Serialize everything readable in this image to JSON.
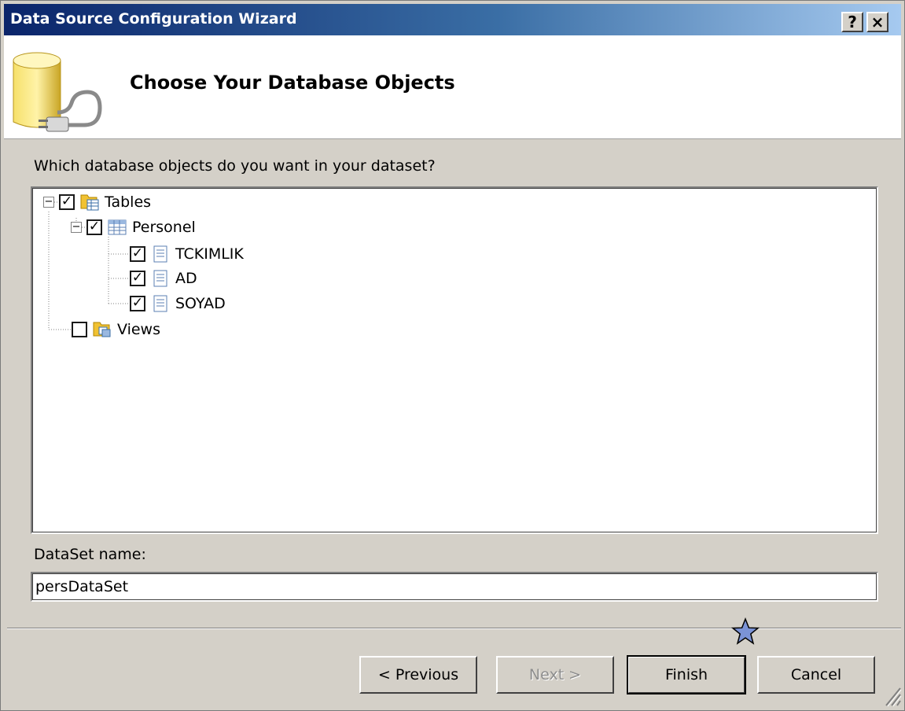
{
  "window": {
    "title": "Data Source Configuration Wizard",
    "help_button": "?",
    "close_button": "×"
  },
  "header": {
    "title": "Choose Your Database Objects",
    "icon": "database-plug-icon"
  },
  "prompt": "Which database objects do you want in your dataset?",
  "tree": {
    "nodes": [
      {
        "label": "Tables",
        "checked": true,
        "expanded": true,
        "icon": "folder-tables-icon"
      },
      {
        "label": "Personel",
        "checked": true,
        "expanded": true,
        "icon": "table-icon"
      },
      {
        "label": "TCKIMLIK",
        "checked": true,
        "icon": "column-icon"
      },
      {
        "label": "AD",
        "checked": true,
        "icon": "column-icon"
      },
      {
        "label": "SOYAD",
        "checked": true,
        "icon": "column-icon"
      },
      {
        "label": "Views",
        "checked": false,
        "icon": "folder-views-icon"
      }
    ]
  },
  "dataset": {
    "label": "DataSet name:",
    "value": "persDataSet"
  },
  "buttons": {
    "previous": "< Previous",
    "next": "Next >",
    "finish": "Finish",
    "cancel": "Cancel"
  },
  "checkmark": "✓",
  "expander_minus": "−"
}
